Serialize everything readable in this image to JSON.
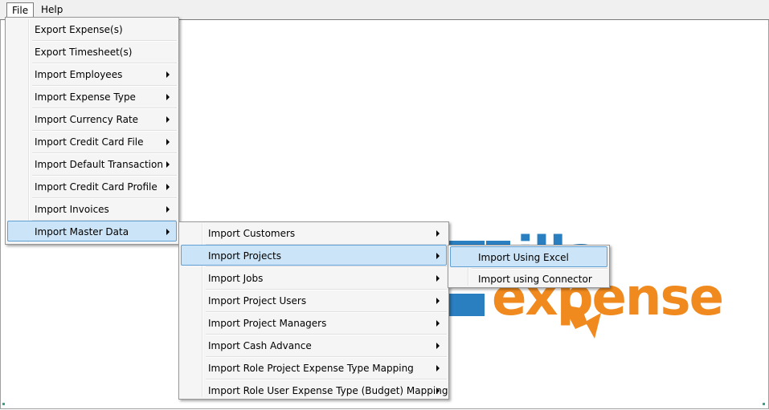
{
  "menubar": {
    "file_label": "File",
    "help_label": "Help"
  },
  "file_menu": {
    "items": [
      {
        "label": "Export Expense(s)"
      },
      {
        "label": "Export Timesheet(s)"
      },
      {
        "label": "Import Employees"
      },
      {
        "label": "Import Expense Type"
      },
      {
        "label": "Import Currency Rate"
      },
      {
        "label": "Import Credit Card File"
      },
      {
        "label": "Import Default Transaction"
      },
      {
        "label": "Import Credit Card Profile"
      },
      {
        "label": "Import Invoices"
      },
      {
        "label": "Import Master Data"
      }
    ]
  },
  "master_data_menu": {
    "items": [
      {
        "label": "Import Customers"
      },
      {
        "label": "Import Projects"
      },
      {
        "label": "Import Jobs"
      },
      {
        "label": "Import Project Users"
      },
      {
        "label": "Import Project Managers"
      },
      {
        "label": "Import Cash Advance"
      },
      {
        "label": "Import Role Project Expense Type Mapping"
      },
      {
        "label": "Import Role User Expense Type (Budget) Mapping"
      }
    ]
  },
  "projects_menu": {
    "items": [
      {
        "label": "Import Using Excel"
      },
      {
        "label": "Import using Connector"
      }
    ]
  },
  "logo": {
    "top_text": "nilla",
    "bottom_text": "expense",
    "colors": {
      "blue": "#2a7fc0",
      "orange": "#f08a1e"
    }
  },
  "colors": {
    "highlight": "#cce4f7",
    "highlight_border": "#5f9fd3"
  }
}
